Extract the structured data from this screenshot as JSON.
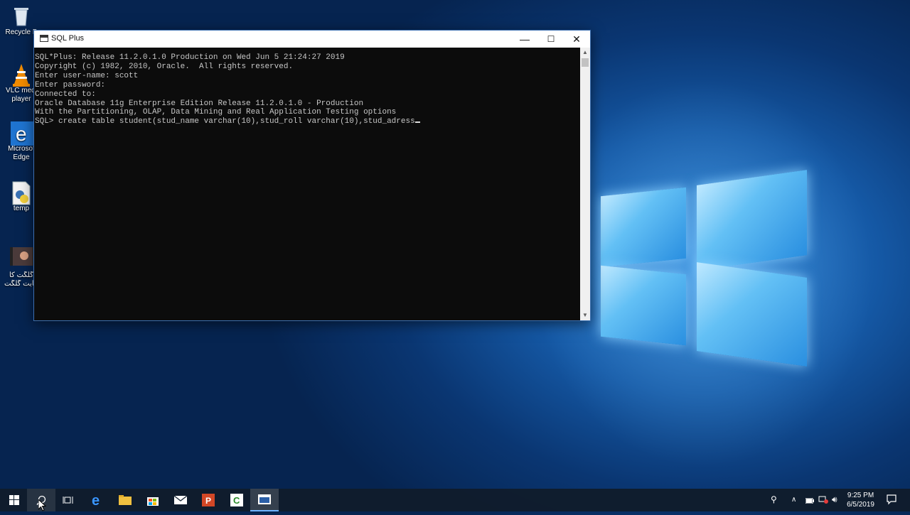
{
  "desktop": {
    "icons": [
      {
        "label": "Recycle B",
        "name": "recycle-bin"
      },
      {
        "label": "VLC media player",
        "line1": "VLC medi",
        "line2": "player"
      },
      {
        "label": "Microsoft Edge",
        "line1": "Microsof",
        "line2": "Edge"
      },
      {
        "label": "temp"
      },
      {
        "line1": "گلگت کا",
        "line2": "جایت گلگت"
      }
    ]
  },
  "window": {
    "title": "SQL Plus",
    "buttons": {
      "minimize": "—",
      "maximize": "☐",
      "close": "✕"
    },
    "console": {
      "lines": [
        "SQL*Plus: Release 11.2.0.1.0 Production on Wed Jun 5 21:24:27 2019",
        "",
        "Copyright (c) 1982, 2010, Oracle.  All rights reserved.",
        "",
        "Enter user-name: scott",
        "Enter password:",
        "",
        "Connected to:",
        "Oracle Database 11g Enterprise Edition Release 11.2.0.1.0 - Production",
        "With the Partitioning, OLAP, Data Mining and Real Application Testing options",
        "",
        "SQL> create table student(stud_name varchar(10),stud_roll varchar(10),stud_adress"
      ]
    }
  },
  "taskbar": {
    "apps": [
      "start-icon",
      "search-icon",
      "task-view-icon",
      "edge-icon",
      "file-explorer-icon",
      "store-icon",
      "mail-icon",
      "powerpoint-icon",
      "camtasia-icon",
      "sqlplus-icon"
    ],
    "clock": {
      "time": "9:25 PM",
      "date": "6/5/2019"
    }
  }
}
